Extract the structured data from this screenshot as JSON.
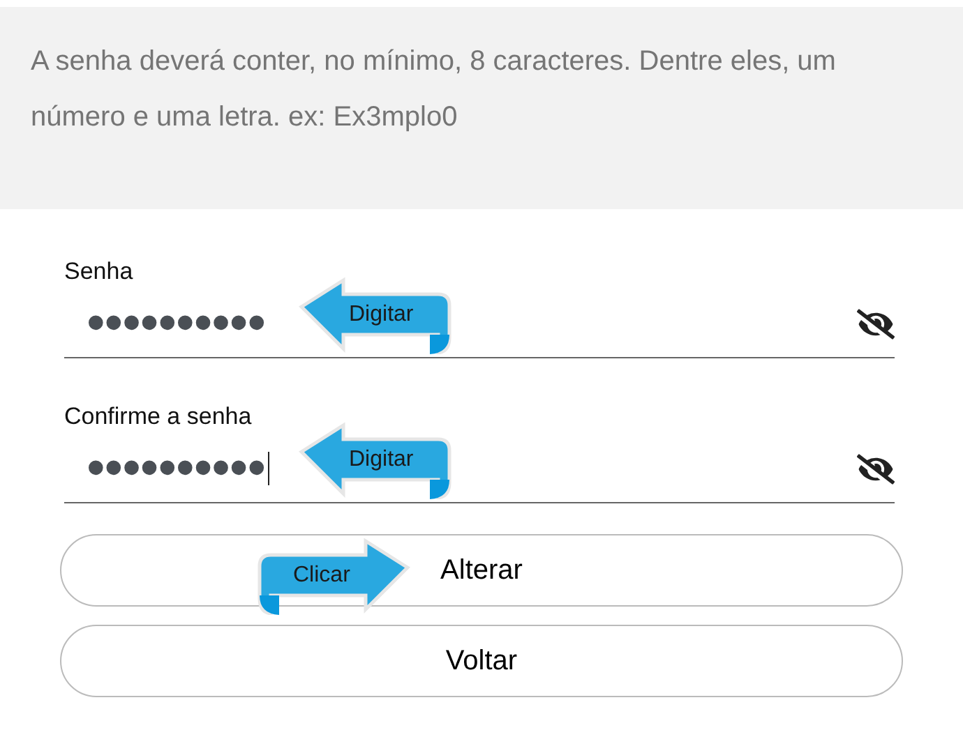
{
  "notice": "A senha deverá conter, no mínimo, 8 caracteres. Dentre eles, um número e uma letra. ex: Ex3mplo0",
  "fields": [
    {
      "label": "Senha",
      "value": "••••••••••",
      "focused": false,
      "callout": {
        "text": "Digitar",
        "kind": "left"
      }
    },
    {
      "label": "Confirme a senha",
      "value": "••••••••••",
      "focused": true,
      "callout": {
        "text": "Digitar",
        "kind": "left"
      }
    }
  ],
  "buttons": [
    {
      "label": "Alterar",
      "callout": {
        "text": "Clicar",
        "kind": "right"
      }
    },
    {
      "label": "Voltar"
    }
  ]
}
